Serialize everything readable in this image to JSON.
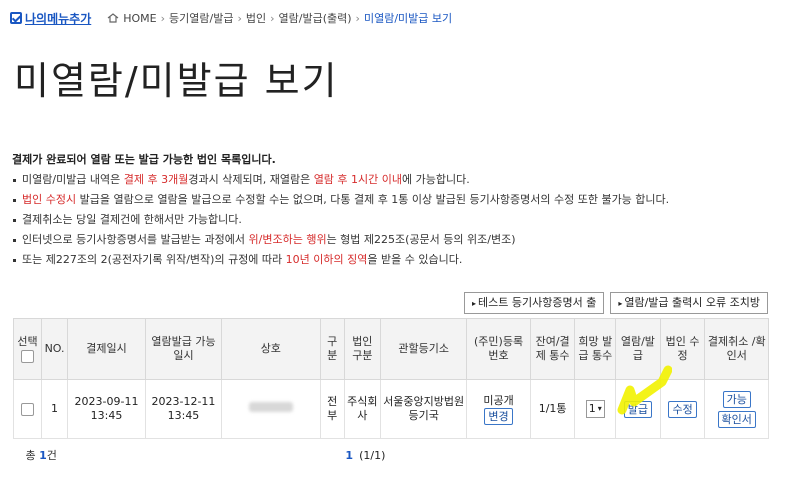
{
  "breadcrumb": {
    "my_menu": "나의메뉴추가",
    "items": [
      "HOME",
      "등기열람/발급",
      "법인",
      "열람/발급(출력)",
      "미열람/미발급 보기"
    ]
  },
  "page_title": "미열람/미발급 보기",
  "notice": {
    "heading": "결제가 완료되어 열람 또는 발급 가능한 법인 목록입니다.",
    "line1": [
      "미열람/미발급 내역은 ",
      "결제 후 3개월",
      "경과시 삭제되며, 재열람은 ",
      "열람 후 1시간 이내",
      "에 가능합니다."
    ],
    "line2": [
      "법인 수정시",
      " 발급을 열람으로 열람을 발급으로 수정할 수는 없으며, 다통 결제 후 1통 이상 발급된 등기사항증명서의 수정 또한 불가능 합니다."
    ],
    "line3": "결제취소는 당일 결제건에 한해서만 가능합니다.",
    "line4": [
      "인터넷으로 등기사항증명서를 발급받는 과정에서 ",
      "위/변조하는 행위",
      "는 형법 제225조(공문서 등의 위조/변조)"
    ],
    "line5": [
      "또는 제227조의 2(공전자기록 위작/변작)의 규정에 따라 ",
      "10년 이하의 징역",
      "을 받을 수 있습니다."
    ]
  },
  "actions": {
    "test_button": "테스트 등기사항증명서 출",
    "error_button": "열람/발급 출력시 오류 조치방"
  },
  "table": {
    "headers": [
      "선택",
      "NO.",
      "결제일시",
      "열람발급 가능일시",
      "상호",
      "구분",
      "법인 구분",
      "관할등기소",
      "(주민)등록번호",
      "잔여/결제 통수",
      "희망 발급 통수",
      "열람/발급",
      "법인 수정",
      "결제취소 /확인서"
    ],
    "rows": [
      {
        "no": "1",
        "paid_at": "2023-09-11 13:45",
        "available_at": "2023-12-11 13:45",
        "kind": "전부",
        "corp_type": "주식회사",
        "registry": "서울중앙지방법원 등기국",
        "reg_no": "미공개",
        "reg_no_button": "변경",
        "remaining": "1/1통",
        "copies": "1",
        "issue_button": "발급",
        "edit_button": "수정",
        "cancel_button": "가능",
        "receipt_button": "확인서"
      }
    ]
  },
  "footer": {
    "total_prefix": "총 ",
    "total_count": "1",
    "total_suffix": "건",
    "page_current": "1",
    "page_info": "(1/1)"
  },
  "colors": {
    "accent": "#1a57c2",
    "warning": "#d62b2b",
    "highlighter": "#f2f200"
  }
}
